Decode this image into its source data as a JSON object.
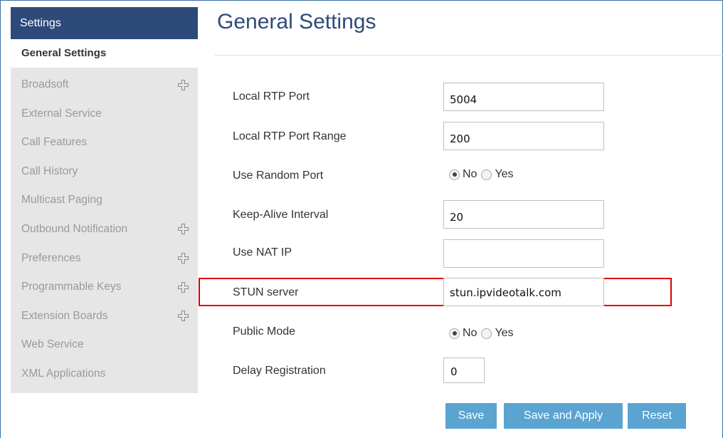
{
  "sidebar": {
    "header": "Settings",
    "active_item": "General Settings",
    "items": [
      {
        "label": "Broadsoft",
        "expandable": true
      },
      {
        "label": "External Service",
        "expandable": false
      },
      {
        "label": "Call Features",
        "expandable": false
      },
      {
        "label": "Call History",
        "expandable": false
      },
      {
        "label": "Multicast Paging",
        "expandable": false
      },
      {
        "label": "Outbound Notification",
        "expandable": true
      },
      {
        "label": "Preferences",
        "expandable": true
      },
      {
        "label": "Programmable Keys",
        "expandable": true
      },
      {
        "label": "Extension Boards",
        "expandable": true
      },
      {
        "label": "Web Service",
        "expandable": false
      },
      {
        "label": "XML Applications",
        "expandable": false
      }
    ],
    "plus_icon": "plus-icon"
  },
  "main": {
    "title": "General Settings",
    "fields": {
      "local_rtp_port": {
        "label": "Local RTP Port",
        "value": "5004"
      },
      "local_rtp_port_range": {
        "label": "Local RTP Port Range",
        "value": "200"
      },
      "use_random_port": {
        "label": "Use Random Port",
        "selected": "No",
        "options": [
          "No",
          "Yes"
        ]
      },
      "keep_alive_interval": {
        "label": "Keep-Alive Interval",
        "value": "20"
      },
      "use_nat_ip": {
        "label": "Use NAT IP",
        "value": ""
      },
      "stun_server": {
        "label": "STUN server",
        "value": "stun.ipvideotalk.com"
      },
      "public_mode": {
        "label": "Public Mode",
        "selected": "No",
        "options": [
          "No",
          "Yes"
        ]
      },
      "delay_registration": {
        "label": "Delay Registration",
        "value": "0"
      }
    }
  },
  "buttons": {
    "save": "Save",
    "save_and_apply": "Save and Apply",
    "reset": "Reset"
  },
  "colors": {
    "sidebar_header_bg": "#2e4a7a",
    "title": "#2e4a7a",
    "button_bg": "#5ba3d0",
    "highlight_border": "#e00000",
    "sidebar_bg": "#e6e6e6",
    "sidebar_text": "#9a9a9a"
  }
}
